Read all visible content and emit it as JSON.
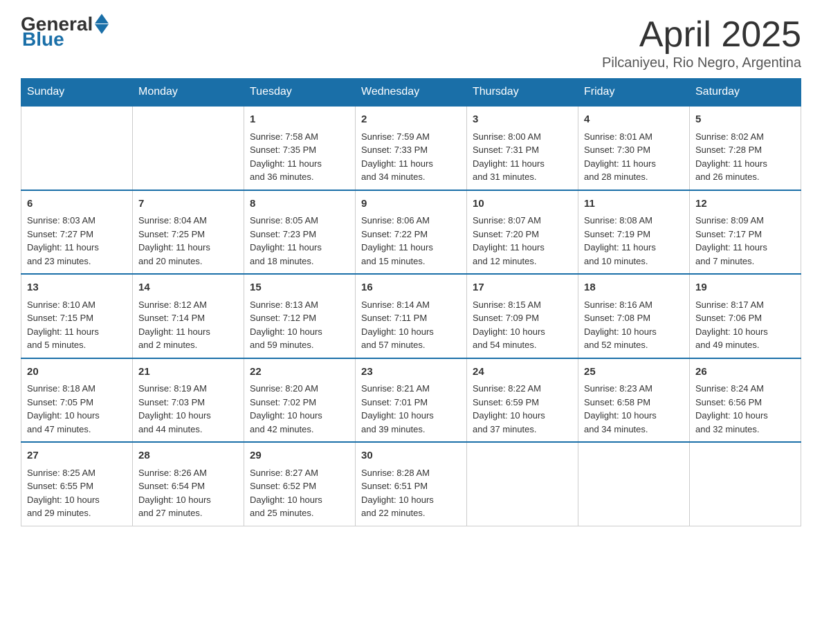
{
  "header": {
    "logo_general": "General",
    "logo_blue": "Blue",
    "title": "April 2025",
    "subtitle": "Pilcaniyeu, Rio Negro, Argentina"
  },
  "weekdays": [
    "Sunday",
    "Monday",
    "Tuesday",
    "Wednesday",
    "Thursday",
    "Friday",
    "Saturday"
  ],
  "weeks": [
    [
      {
        "day": "",
        "info": ""
      },
      {
        "day": "",
        "info": ""
      },
      {
        "day": "1",
        "info": "Sunrise: 7:58 AM\nSunset: 7:35 PM\nDaylight: 11 hours\nand 36 minutes."
      },
      {
        "day": "2",
        "info": "Sunrise: 7:59 AM\nSunset: 7:33 PM\nDaylight: 11 hours\nand 34 minutes."
      },
      {
        "day": "3",
        "info": "Sunrise: 8:00 AM\nSunset: 7:31 PM\nDaylight: 11 hours\nand 31 minutes."
      },
      {
        "day": "4",
        "info": "Sunrise: 8:01 AM\nSunset: 7:30 PM\nDaylight: 11 hours\nand 28 minutes."
      },
      {
        "day": "5",
        "info": "Sunrise: 8:02 AM\nSunset: 7:28 PM\nDaylight: 11 hours\nand 26 minutes."
      }
    ],
    [
      {
        "day": "6",
        "info": "Sunrise: 8:03 AM\nSunset: 7:27 PM\nDaylight: 11 hours\nand 23 minutes."
      },
      {
        "day": "7",
        "info": "Sunrise: 8:04 AM\nSunset: 7:25 PM\nDaylight: 11 hours\nand 20 minutes."
      },
      {
        "day": "8",
        "info": "Sunrise: 8:05 AM\nSunset: 7:23 PM\nDaylight: 11 hours\nand 18 minutes."
      },
      {
        "day": "9",
        "info": "Sunrise: 8:06 AM\nSunset: 7:22 PM\nDaylight: 11 hours\nand 15 minutes."
      },
      {
        "day": "10",
        "info": "Sunrise: 8:07 AM\nSunset: 7:20 PM\nDaylight: 11 hours\nand 12 minutes."
      },
      {
        "day": "11",
        "info": "Sunrise: 8:08 AM\nSunset: 7:19 PM\nDaylight: 11 hours\nand 10 minutes."
      },
      {
        "day": "12",
        "info": "Sunrise: 8:09 AM\nSunset: 7:17 PM\nDaylight: 11 hours\nand 7 minutes."
      }
    ],
    [
      {
        "day": "13",
        "info": "Sunrise: 8:10 AM\nSunset: 7:15 PM\nDaylight: 11 hours\nand 5 minutes."
      },
      {
        "day": "14",
        "info": "Sunrise: 8:12 AM\nSunset: 7:14 PM\nDaylight: 11 hours\nand 2 minutes."
      },
      {
        "day": "15",
        "info": "Sunrise: 8:13 AM\nSunset: 7:12 PM\nDaylight: 10 hours\nand 59 minutes."
      },
      {
        "day": "16",
        "info": "Sunrise: 8:14 AM\nSunset: 7:11 PM\nDaylight: 10 hours\nand 57 minutes."
      },
      {
        "day": "17",
        "info": "Sunrise: 8:15 AM\nSunset: 7:09 PM\nDaylight: 10 hours\nand 54 minutes."
      },
      {
        "day": "18",
        "info": "Sunrise: 8:16 AM\nSunset: 7:08 PM\nDaylight: 10 hours\nand 52 minutes."
      },
      {
        "day": "19",
        "info": "Sunrise: 8:17 AM\nSunset: 7:06 PM\nDaylight: 10 hours\nand 49 minutes."
      }
    ],
    [
      {
        "day": "20",
        "info": "Sunrise: 8:18 AM\nSunset: 7:05 PM\nDaylight: 10 hours\nand 47 minutes."
      },
      {
        "day": "21",
        "info": "Sunrise: 8:19 AM\nSunset: 7:03 PM\nDaylight: 10 hours\nand 44 minutes."
      },
      {
        "day": "22",
        "info": "Sunrise: 8:20 AM\nSunset: 7:02 PM\nDaylight: 10 hours\nand 42 minutes."
      },
      {
        "day": "23",
        "info": "Sunrise: 8:21 AM\nSunset: 7:01 PM\nDaylight: 10 hours\nand 39 minutes."
      },
      {
        "day": "24",
        "info": "Sunrise: 8:22 AM\nSunset: 6:59 PM\nDaylight: 10 hours\nand 37 minutes."
      },
      {
        "day": "25",
        "info": "Sunrise: 8:23 AM\nSunset: 6:58 PM\nDaylight: 10 hours\nand 34 minutes."
      },
      {
        "day": "26",
        "info": "Sunrise: 8:24 AM\nSunset: 6:56 PM\nDaylight: 10 hours\nand 32 minutes."
      }
    ],
    [
      {
        "day": "27",
        "info": "Sunrise: 8:25 AM\nSunset: 6:55 PM\nDaylight: 10 hours\nand 29 minutes."
      },
      {
        "day": "28",
        "info": "Sunrise: 8:26 AM\nSunset: 6:54 PM\nDaylight: 10 hours\nand 27 minutes."
      },
      {
        "day": "29",
        "info": "Sunrise: 8:27 AM\nSunset: 6:52 PM\nDaylight: 10 hours\nand 25 minutes."
      },
      {
        "day": "30",
        "info": "Sunrise: 8:28 AM\nSunset: 6:51 PM\nDaylight: 10 hours\nand 22 minutes."
      },
      {
        "day": "",
        "info": ""
      },
      {
        "day": "",
        "info": ""
      },
      {
        "day": "",
        "info": ""
      }
    ]
  ]
}
